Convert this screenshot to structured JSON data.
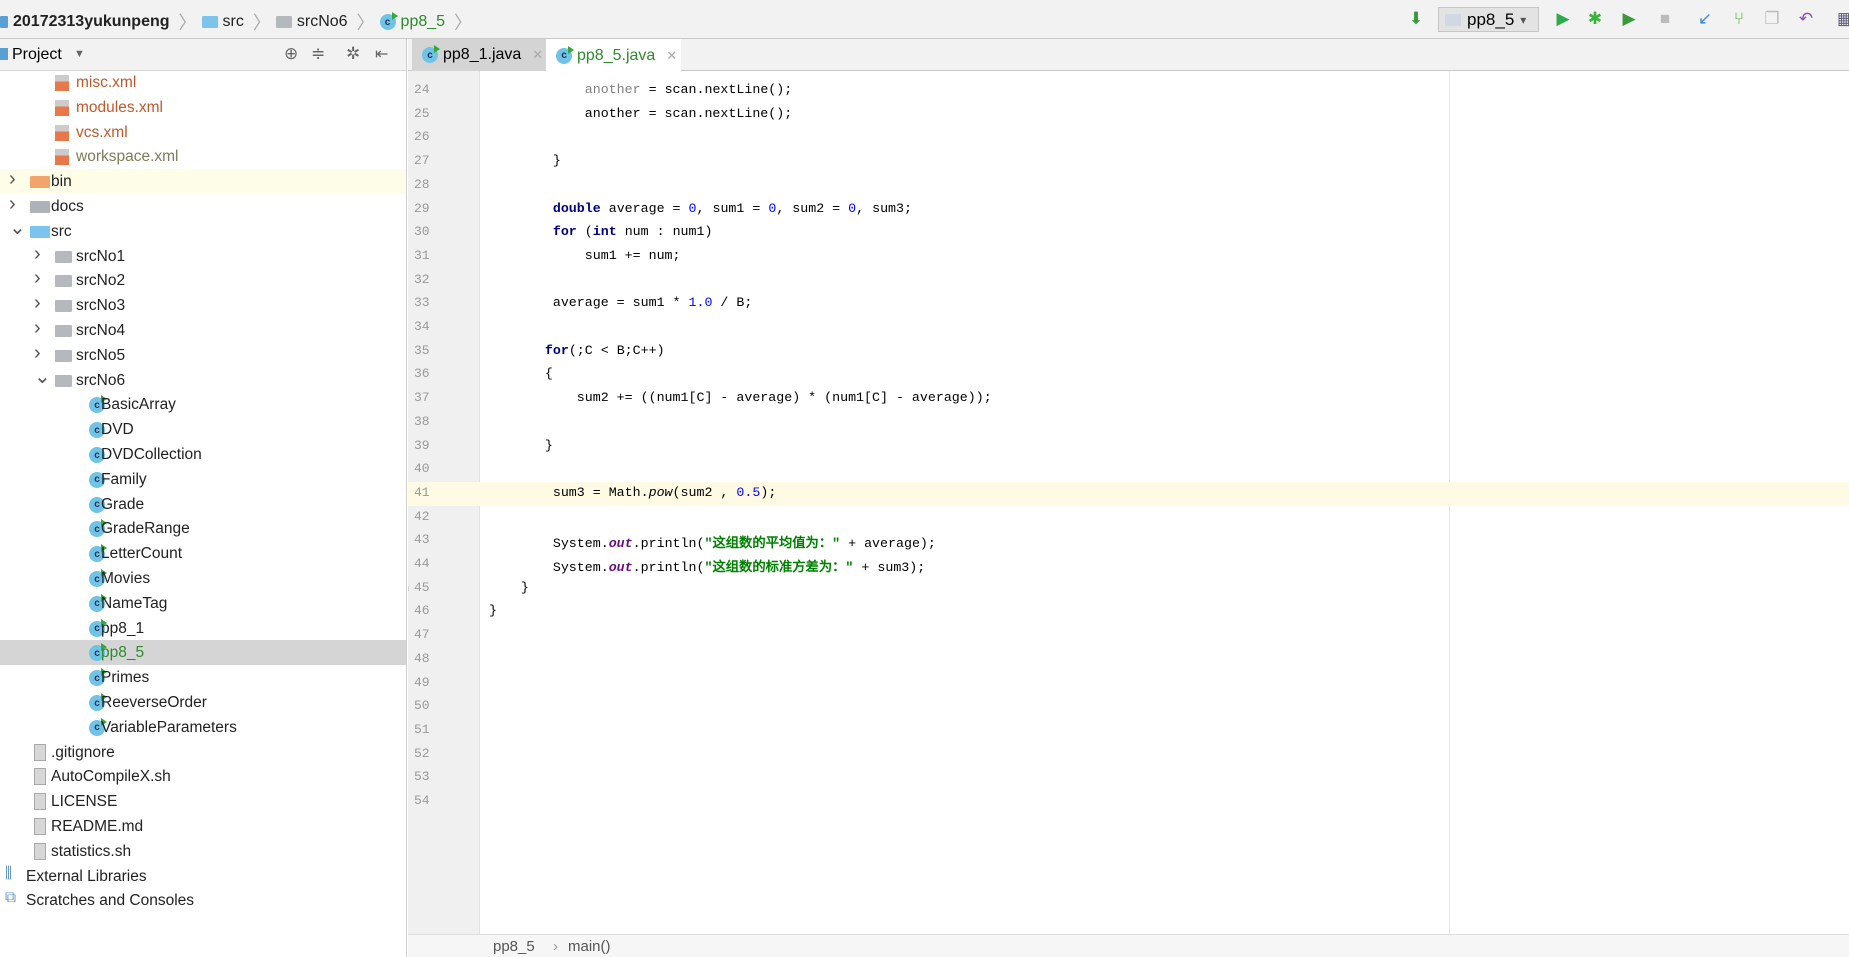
{
  "breadcrumb": [
    "20172313yukunpeng",
    "src",
    "srcNo6",
    "pp8_5"
  ],
  "toolbar": {
    "run_config": "pp8_5",
    "icons": [
      "sort-binary-icon",
      "run-icon",
      "debug-icon",
      "coverage-icon",
      "stop-icon",
      "vcs-update-icon",
      "vcs-commit-icon",
      "vcs-compare-icon",
      "revert-icon",
      "project-structure-icon"
    ]
  },
  "project_panel": {
    "title": "Project"
  },
  "tree": [
    {
      "label": "misc.xml",
      "type": "xml",
      "indent": 1,
      "color": "#c0592b"
    },
    {
      "label": "modules.xml",
      "type": "xml",
      "indent": 1,
      "color": "#c0592b"
    },
    {
      "label": "vcs.xml",
      "type": "xml",
      "indent": 1,
      "color": "#c0592b"
    },
    {
      "label": "workspace.xml",
      "type": "xml",
      "indent": 1,
      "color": "#7d7d5a"
    },
    {
      "label": "bin",
      "type": "folder-orange",
      "indent": 0,
      "arrow": "right",
      "highlight": true
    },
    {
      "label": "docs",
      "type": "folder-gray",
      "indent": 0,
      "arrow": "right"
    },
    {
      "label": "src",
      "type": "folder-blue",
      "indent": 0,
      "arrow": "down"
    },
    {
      "label": "srcNo1",
      "type": "package",
      "indent": 1,
      "arrow": "right"
    },
    {
      "label": "srcNo2",
      "type": "package",
      "indent": 1,
      "arrow": "right"
    },
    {
      "label": "srcNo3",
      "type": "package",
      "indent": 1,
      "arrow": "right"
    },
    {
      "label": "srcNo4",
      "type": "package",
      "indent": 1,
      "arrow": "right"
    },
    {
      "label": "srcNo5",
      "type": "package",
      "indent": 1,
      "arrow": "right"
    },
    {
      "label": "srcNo6",
      "type": "package",
      "indent": 1,
      "arrow": "down"
    },
    {
      "label": "BasicArray",
      "type": "class-run",
      "indent": 2
    },
    {
      "label": "DVD",
      "type": "class",
      "indent": 2
    },
    {
      "label": "DVDCollection",
      "type": "class",
      "indent": 2
    },
    {
      "label": "Family",
      "type": "class",
      "indent": 2
    },
    {
      "label": "Grade",
      "type": "class",
      "indent": 2
    },
    {
      "label": "GradeRange",
      "type": "class-run",
      "indent": 2
    },
    {
      "label": "LetterCount",
      "type": "class-run",
      "indent": 2
    },
    {
      "label": "Movies",
      "type": "class-run",
      "indent": 2
    },
    {
      "label": "NameTag",
      "type": "class-run",
      "indent": 2
    },
    {
      "label": "pp8_1",
      "type": "class-run",
      "indent": 2
    },
    {
      "label": "pp8_5",
      "type": "class-run",
      "indent": 2,
      "selected": true,
      "color": "#2e8b2e"
    },
    {
      "label": "Primes",
      "type": "class-run",
      "indent": 2
    },
    {
      "label": "ReeverseOrder",
      "type": "class-run",
      "indent": 2
    },
    {
      "label": "VariableParameters",
      "type": "class-run",
      "indent": 2
    },
    {
      "label": ".gitignore",
      "type": "file",
      "indent": 0
    },
    {
      "label": "AutoCompileX.sh",
      "type": "file",
      "indent": 0
    },
    {
      "label": "LICENSE",
      "type": "file",
      "indent": 0
    },
    {
      "label": "README.md",
      "type": "file",
      "indent": 0
    },
    {
      "label": "statistics.sh",
      "type": "file",
      "indent": 0
    },
    {
      "label": "External Libraries",
      "type": "libraries",
      "indent": -1
    },
    {
      "label": "Scratches and Consoles",
      "type": "scratches",
      "indent": -1
    }
  ],
  "tabs": [
    {
      "label": "pp8_1.java",
      "active": false
    },
    {
      "label": "pp8_5.java",
      "active": true
    }
  ],
  "code": [
    {
      "n": 24,
      "t": [
        [
          "            ",
          ""
        ],
        [
          "another",
          "gr"
        ],
        [
          " = scan.nextLine();",
          ""
        ]
      ]
    },
    {
      "n": 25,
      "t": [
        [
          "            another = scan.nextLine();",
          ""
        ]
      ]
    },
    {
      "n": 26,
      "t": []
    },
    {
      "n": 27,
      "t": [
        [
          "        }",
          ""
        ]
      ]
    },
    {
      "n": 28,
      "t": []
    },
    {
      "n": 29,
      "t": [
        [
          "        ",
          ""
        ],
        [
          "double",
          "kw"
        ],
        [
          " average = ",
          ""
        ],
        [
          "0",
          "num"
        ],
        [
          ", sum1 = ",
          ""
        ],
        [
          "0",
          "num"
        ],
        [
          ", sum2 = ",
          ""
        ],
        [
          "0",
          "num"
        ],
        [
          ", sum3;",
          ""
        ]
      ]
    },
    {
      "n": 30,
      "t": [
        [
          "        ",
          ""
        ],
        [
          "for",
          "kw"
        ],
        [
          " (",
          ""
        ],
        [
          "int",
          "kw"
        ],
        [
          " num : num1)",
          ""
        ]
      ]
    },
    {
      "n": 31,
      "t": [
        [
          "            sum1 += num;",
          ""
        ]
      ]
    },
    {
      "n": 32,
      "t": []
    },
    {
      "n": 33,
      "t": [
        [
          "        average = sum1 * ",
          ""
        ],
        [
          "1.0",
          "num"
        ],
        [
          " / B;",
          ""
        ]
      ]
    },
    {
      "n": 34,
      "t": []
    },
    {
      "n": 35,
      "t": [
        [
          "       ",
          ""
        ],
        [
          "for",
          "kw"
        ],
        [
          "(;C < B;C++)",
          ""
        ]
      ]
    },
    {
      "n": 36,
      "t": [
        [
          "       {",
          ""
        ]
      ]
    },
    {
      "n": 37,
      "t": [
        [
          "           sum2 += ((num1[C] - average) * (num1[C] - average));",
          ""
        ]
      ]
    },
    {
      "n": 38,
      "t": []
    },
    {
      "n": 39,
      "t": [
        [
          "       }",
          ""
        ]
      ]
    },
    {
      "n": 40,
      "t": []
    },
    {
      "n": 41,
      "t": [
        [
          "        sum3 = Math.",
          ""
        ],
        [
          "pow",
          "it"
        ],
        [
          "(sum2 , ",
          ""
        ],
        [
          "0.5",
          "num"
        ],
        [
          ");",
          ""
        ]
      ],
      "current": true
    },
    {
      "n": 42,
      "t": []
    },
    {
      "n": 43,
      "t": [
        [
          "        System.",
          ""
        ],
        [
          "out",
          "fld"
        ],
        [
          ".println(",
          ""
        ],
        [
          "\"这组数的平均值为：\"",
          "str"
        ],
        [
          " + average);",
          ""
        ]
      ]
    },
    {
      "n": 44,
      "t": [
        [
          "        System.",
          ""
        ],
        [
          "out",
          "fld"
        ],
        [
          ".println(",
          ""
        ],
        [
          "\"这组数的标准方差为：\"",
          "str"
        ],
        [
          " + sum3);",
          ""
        ]
      ]
    },
    {
      "n": 45,
      "t": [
        [
          "    }",
          ""
        ]
      ]
    },
    {
      "n": 46,
      "t": [
        [
          "}",
          ""
        ]
      ]
    },
    {
      "n": 47,
      "t": []
    },
    {
      "n": 48,
      "t": []
    },
    {
      "n": 49,
      "t": []
    },
    {
      "n": 50,
      "t": []
    },
    {
      "n": 51,
      "t": []
    },
    {
      "n": 52,
      "t": []
    },
    {
      "n": 53,
      "t": []
    },
    {
      "n": 54,
      "t": []
    }
  ],
  "status_breadcrumb": {
    "class": "pp8_5",
    "sep": "›",
    "method": "main()"
  }
}
